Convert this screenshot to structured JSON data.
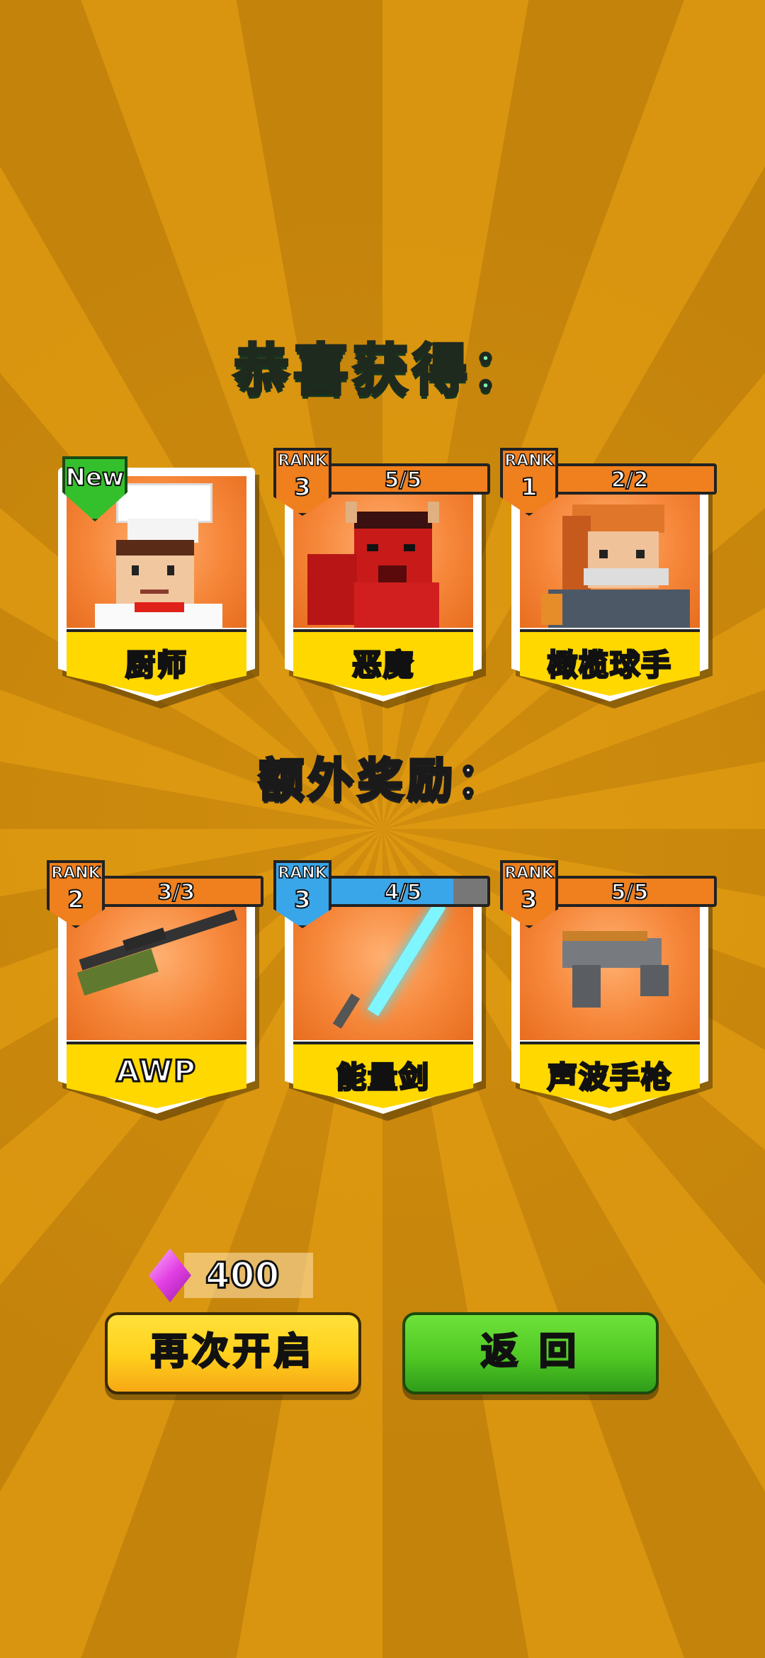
{
  "heading": {
    "title": "恭喜获得：",
    "bonus": "额外奖励："
  },
  "characters": [
    {
      "name": "厨师",
      "new_label": "New"
    },
    {
      "name": "恶魔",
      "rank_label": "RANK",
      "rank": "3",
      "progress": "5/5"
    },
    {
      "name": "橄榄球手",
      "rank_label": "RANK",
      "rank": "1",
      "progress": "2/2"
    }
  ],
  "weapons": [
    {
      "name": "AWP",
      "rank_label": "RANK",
      "rank": "2",
      "progress": "3/3"
    },
    {
      "name": "能量剑",
      "rank_label": "RANK",
      "rank": "3",
      "progress": "4/5",
      "progress_fraction": 0.8
    },
    {
      "name": "声波手枪",
      "rank_label": "RANK",
      "rank": "3",
      "progress": "5/5"
    }
  ],
  "currency": {
    "icon": "gem-icon",
    "amount": "400"
  },
  "buttons": {
    "reopen": "再次开启",
    "back": "返 回"
  },
  "colors": {
    "title": "#7ff0b0",
    "card_orange": "#f07f1e",
    "card_blue": "#3aa6ea",
    "name_bar": "#ffd800",
    "new_green": "#34c02c"
  }
}
